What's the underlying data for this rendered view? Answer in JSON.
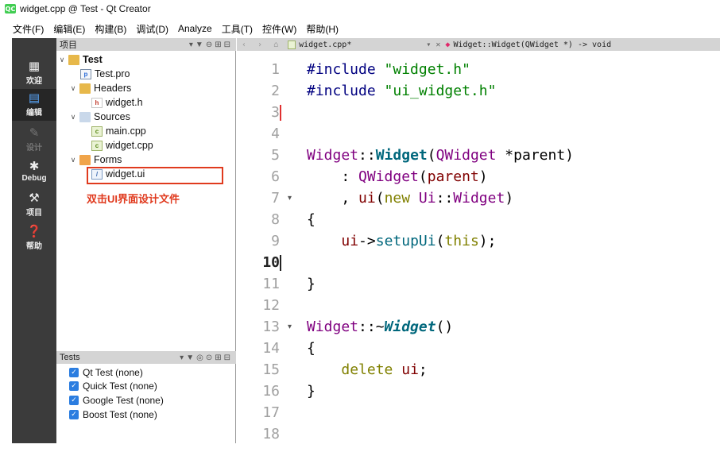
{
  "window": {
    "title": "widget.cpp @ Test - Qt Creator",
    "app_icon": "QC"
  },
  "menu": [
    "文件(F)",
    "编辑(E)",
    "构建(B)",
    "调试(D)",
    "Analyze",
    "工具(T)",
    "控件(W)",
    "帮助(H)"
  ],
  "modes": [
    {
      "label": "欢迎",
      "icon": "grid-icon"
    },
    {
      "label": "编辑",
      "icon": "edit-icon"
    },
    {
      "label": "设计",
      "icon": "design-icon"
    },
    {
      "label": "Debug",
      "icon": "bug-icon"
    },
    {
      "label": "项目",
      "icon": "wrench-icon"
    },
    {
      "label": "帮助",
      "icon": "help-icon"
    }
  ],
  "projects_pane": {
    "title": "项目"
  },
  "tree": {
    "project": "Test",
    "pro_file": "Test.pro",
    "headers": "Headers",
    "header_file": "widget.h",
    "sources": "Sources",
    "source_main": "main.cpp",
    "source_widget": "widget.cpp",
    "forms": "Forms",
    "form_file": "widget.ui"
  },
  "annotation": "双击UI界面设计文件",
  "tests_pane": {
    "title": "Tests",
    "items": [
      "Qt Test (none)",
      "Quick Test (none)",
      "Google Test (none)",
      "Boost Test (none)"
    ]
  },
  "editor": {
    "file_tab": "widget.cpp*",
    "symbol": "Widget::Widget(QWidget *) -> void",
    "current_line": 10,
    "line_numbers": [
      "1",
      "2",
      "3",
      "4",
      "5",
      "6",
      "7",
      "8",
      "9",
      "10",
      "11",
      "12",
      "13",
      "14",
      "15",
      "16",
      "17",
      "18"
    ]
  },
  "colors": {
    "annotation_red": "#e03a1e",
    "sidebar": "#3b3b3b",
    "checkbox": "#2b7de0"
  }
}
